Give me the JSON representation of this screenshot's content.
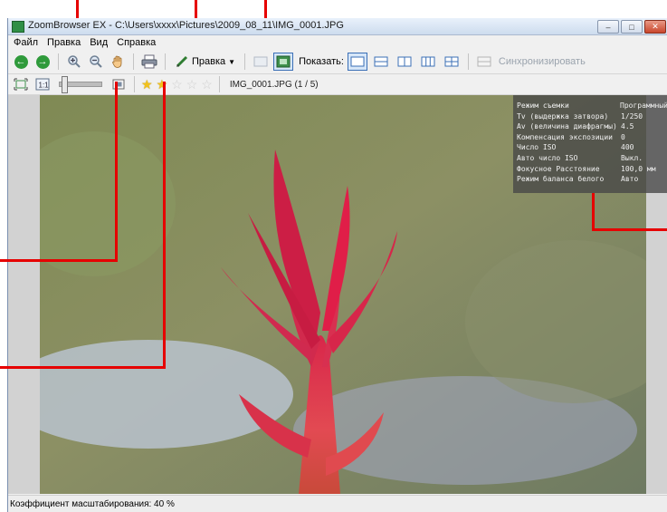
{
  "window": {
    "title": "ZoomBrowser EX - C:\\Users\\xxxx\\Pictures\\2009_08_11\\IMG_0001.JPG",
    "buttons": [
      "minimize",
      "maximize",
      "close"
    ]
  },
  "menu": [
    "Файл",
    "Правка",
    "Вид",
    "Справка"
  ],
  "toolbar": {
    "edit_label": "Правка",
    "show_label": "Показать:",
    "sync_label": "Синхронизировать"
  },
  "toolbar2": {
    "rating": 2,
    "rating_max": 5,
    "file_label": "IMG_0001.JPG (1 / 5)"
  },
  "exif": [
    {
      "k": "Режим съемки",
      "v": "Программный"
    },
    {
      "k": "Tv (выдержка затвора)",
      "v": "1/250"
    },
    {
      "k": "Av (величина диафрагмы)",
      "v": "4.5"
    },
    {
      "k": "Компенсация экспозиции",
      "v": "0"
    },
    {
      "k": "Число ISO",
      "v": "400"
    },
    {
      "k": "Авто число ISO",
      "v": "Выкл."
    },
    {
      "k": "Фокусное Расстояние",
      "v": "100,0 мм"
    },
    {
      "k": "Режим баланса белого",
      "v": "Авто"
    }
  ],
  "status": "Коэффициент масштабирования: 40 %",
  "colors": {
    "callout": "#e60000",
    "accent": "#3b6fb6",
    "nav_green": "#2f9a3b"
  }
}
